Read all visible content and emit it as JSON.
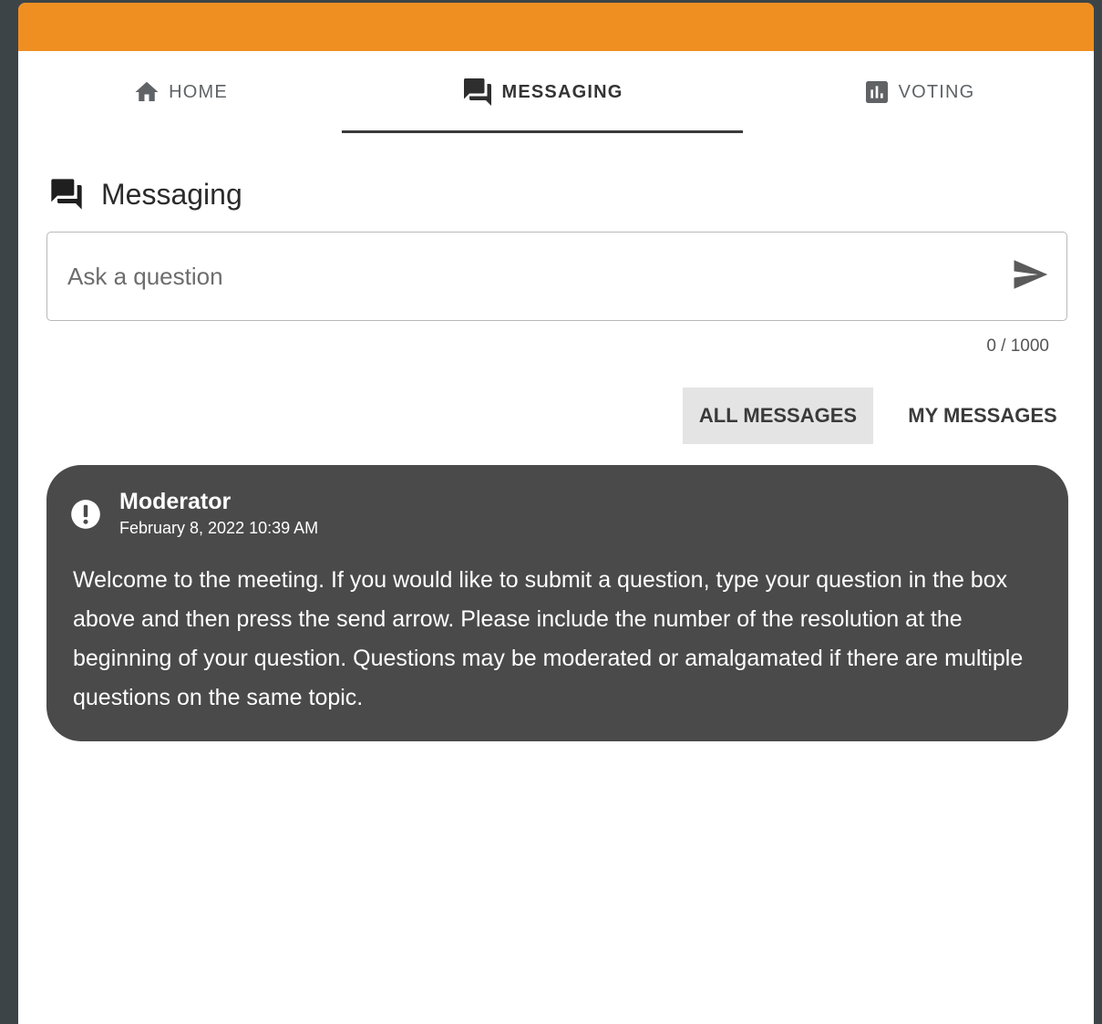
{
  "colors": {
    "accent": "#ef8f22",
    "background": "#3c4447",
    "message_bg": "#4a4a4a"
  },
  "tabs": [
    {
      "label": "HOME",
      "icon": "home-icon",
      "active": false
    },
    {
      "label": "MESSAGING",
      "icon": "forum-icon",
      "active": true
    },
    {
      "label": "VOTING",
      "icon": "bar-chart-icon",
      "active": false
    }
  ],
  "section": {
    "title": "Messaging",
    "icon": "forum-icon"
  },
  "question_input": {
    "placeholder": "Ask a question",
    "value": "",
    "counter": "0 / 1000"
  },
  "filters": {
    "all_label": "ALL MESSAGES",
    "mine_label": "MY MESSAGES",
    "selected": "ALL MESSAGES"
  },
  "messages": [
    {
      "author": "Moderator",
      "timestamp": "February 8, 2022 10:39 AM",
      "icon": "alert-circle-icon",
      "body": "Welcome to the meeting. If you would like to submit a question, type your question in the box above and then press the send arrow. Please include the number of the resolution at the beginning of your question. Questions may be moderated or amalgamated if there are multiple questions on the same topic."
    }
  ]
}
